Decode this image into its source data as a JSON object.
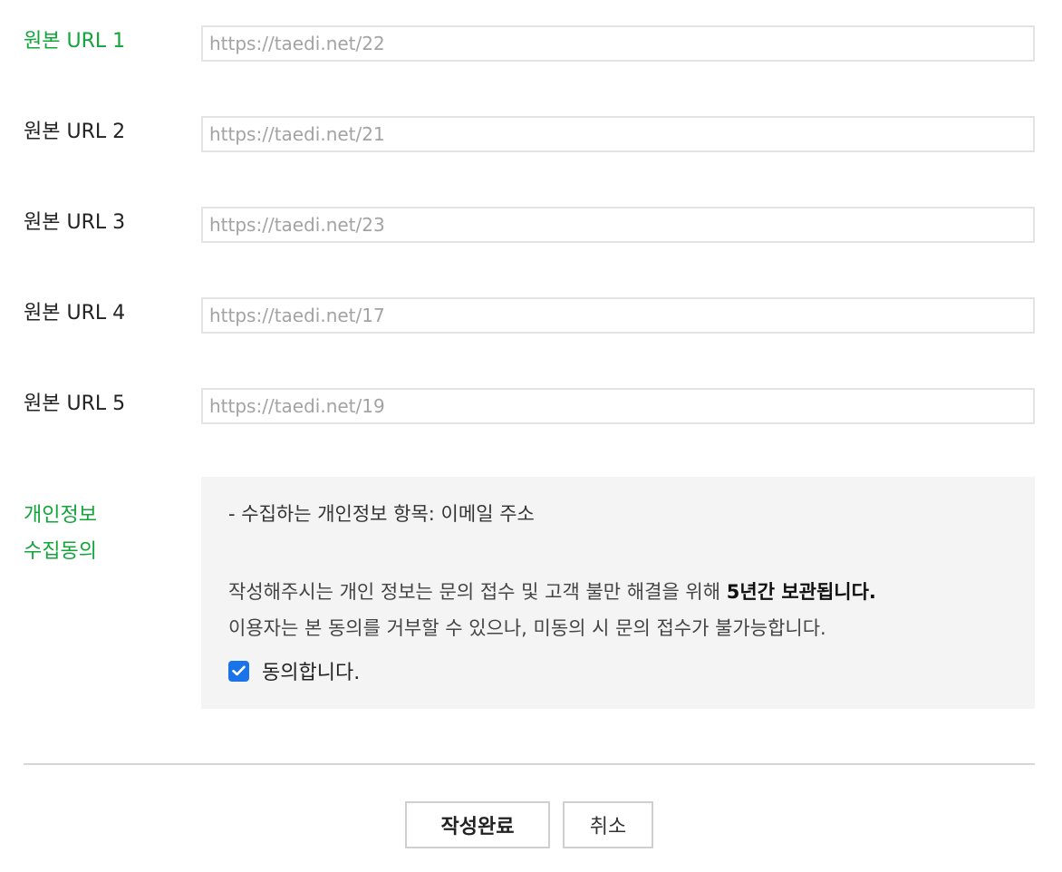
{
  "url_fields": [
    {
      "label": "원본 URL 1",
      "placeholder": "https://taedi.net/22"
    },
    {
      "label": "원본 URL 2",
      "placeholder": "https://taedi.net/21"
    },
    {
      "label": "원본 URL 3",
      "placeholder": "https://taedi.net/23"
    },
    {
      "label": "원본 URL 4",
      "placeholder": "https://taedi.net/17"
    },
    {
      "label": "원본 URL 5",
      "placeholder": "https://taedi.net/19"
    }
  ],
  "consent": {
    "label_line1": "개인정보",
    "label_line2": "수집동의",
    "items": "- 수집하는 개인정보 항목: 이메일 주소",
    "notice_prefix": "작성해주시는 개인 정보는 문의 접수 및 고객 불만 해결을 위해 ",
    "notice_emphasis": "5년간 보관됩니다.",
    "notice_line2": "이용자는 본 동의를 거부할 수 있으나, 미동의 시 문의 접수가 불가능합니다.",
    "agree_label": "동의합니다.",
    "agreed": true
  },
  "buttons": {
    "submit": "작성완료",
    "cancel": "취소"
  },
  "colors": {
    "active_label": "#12a53a",
    "checkbox": "#1a73e8",
    "panel_bg": "#f4f4f4"
  }
}
